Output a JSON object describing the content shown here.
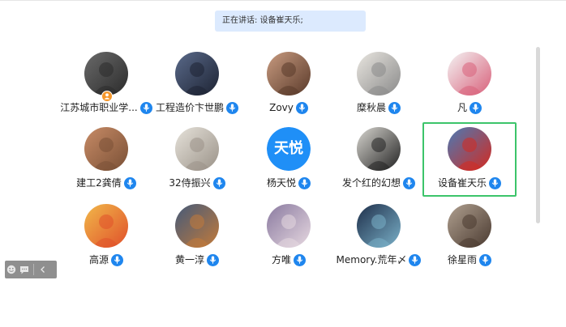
{
  "status": {
    "speaking_text": "正在讲话: 设备崔天乐;"
  },
  "participants": [
    {
      "name": "江苏城市职业学...",
      "avatar": "photo",
      "avatar_colors": [
        "#6a6a6a",
        "#2b2b2b"
      ],
      "host": true
    },
    {
      "name": "工程造价卞世鹏",
      "avatar": "photo",
      "avatar_colors": [
        "#5a6a8a",
        "#1d2333"
      ]
    },
    {
      "name": "Zovy",
      "avatar": "photo",
      "avatar_colors": [
        "#c89b80",
        "#5a3a2a"
      ]
    },
    {
      "name": "糜秋晨",
      "avatar": "photo",
      "avatar_colors": [
        "#e9e6e0",
        "#8a8a8a"
      ]
    },
    {
      "name": "凡",
      "avatar": "photo",
      "avatar_colors": [
        "#f4f4f4",
        "#d8607a"
      ]
    },
    {
      "name": "建工2龚倩",
      "avatar": "photo",
      "avatar_colors": [
        "#c78b66",
        "#7a5036"
      ]
    },
    {
      "name": "32侍振兴",
      "avatar": "photo",
      "avatar_colors": [
        "#e6e2da",
        "#9a9288"
      ]
    },
    {
      "name": "杨天悦",
      "avatar": "text",
      "avatar_text": "天悦",
      "avatar_colors": [
        "#1f8ff7",
        "#1f8ff7"
      ]
    },
    {
      "name": "发个红的幻想",
      "avatar": "photo",
      "avatar_colors": [
        "#d8d6d0",
        "#222222"
      ]
    },
    {
      "name": "设备崔天乐",
      "avatar": "photo",
      "avatar_colors": [
        "#4a7ab5",
        "#d42a20"
      ],
      "highlighted": true
    },
    {
      "name": "高源",
      "avatar": "photo",
      "avatar_colors": [
        "#f1b84a",
        "#e0502a"
      ]
    },
    {
      "name": "黄一淳",
      "avatar": "photo",
      "avatar_colors": [
        "#445a7a",
        "#c27a3a"
      ]
    },
    {
      "name": "方唯",
      "avatar": "photo",
      "avatar_colors": [
        "#8a7aa0",
        "#e6d8e0"
      ]
    },
    {
      "name": "Memory.荒年〆",
      "avatar": "photo",
      "avatar_colors": [
        "#1e2f4a",
        "#7ab0c8"
      ]
    },
    {
      "name": "徐星雨",
      "avatar": "photo",
      "avatar_colors": [
        "#b0a090",
        "#4a3a30"
      ]
    }
  ],
  "toolbar": {
    "emoji_icon": "emoji-icon",
    "chat_icon": "chat-bubble-icon",
    "collapse_icon": "chevron-left-icon"
  },
  "colors": {
    "accent": "#1f86ee",
    "highlight_border": "#3cc46a",
    "speaking_bg": "#dceafe",
    "host_badge": "#f5972b"
  }
}
